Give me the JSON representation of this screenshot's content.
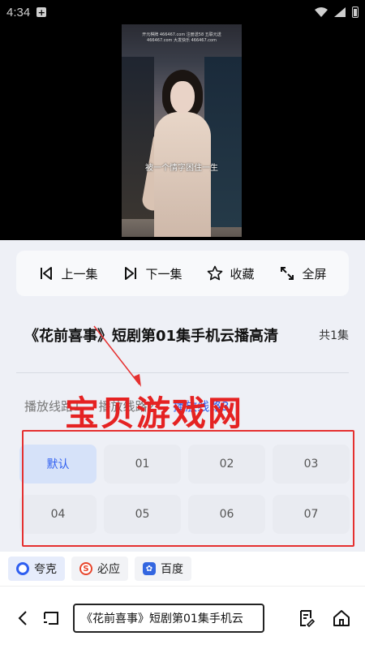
{
  "status": {
    "time": "4:34"
  },
  "video": {
    "subtitle": "被一个情字困住一生",
    "watermark_line1": "开元棋牌 466467.com 注册送58 五联元送",
    "watermark_line2": "466467.com 大发快乐 466467.com"
  },
  "controls": {
    "prev": "上一集",
    "next": "下一集",
    "favorite": "收藏",
    "fullscreen": "全屏"
  },
  "title": {
    "text": "《花前喜事》短剧第01集手机云播高清",
    "episode_count": "共1集"
  },
  "routes": [
    {
      "label": "播放线路1",
      "active": false
    },
    {
      "label": "播放线路2",
      "active": false
    },
    {
      "label": "播放线路3",
      "active": true
    }
  ],
  "episodes": [
    {
      "label": "默认",
      "active": true
    },
    {
      "label": "01",
      "active": false
    },
    {
      "label": "02",
      "active": false
    },
    {
      "label": "03",
      "active": false
    },
    {
      "label": "04",
      "active": false
    },
    {
      "label": "05",
      "active": false
    },
    {
      "label": "06",
      "active": false
    },
    {
      "label": "07",
      "active": false
    }
  ],
  "overlay": {
    "watermark_text": "宝贝游戏网"
  },
  "engines": [
    {
      "label": "夸克",
      "icon": "quark-icon",
      "active": true
    },
    {
      "label": "必应",
      "icon": "sogou-icon",
      "active": false
    },
    {
      "label": "百度",
      "icon": "baidu-icon",
      "active": false
    }
  ],
  "toolbar": {
    "address": "《花前喜事》短剧第01集手机云"
  },
  "colors": {
    "accent": "#2f5ff0",
    "annotation_red": "#e53030"
  }
}
